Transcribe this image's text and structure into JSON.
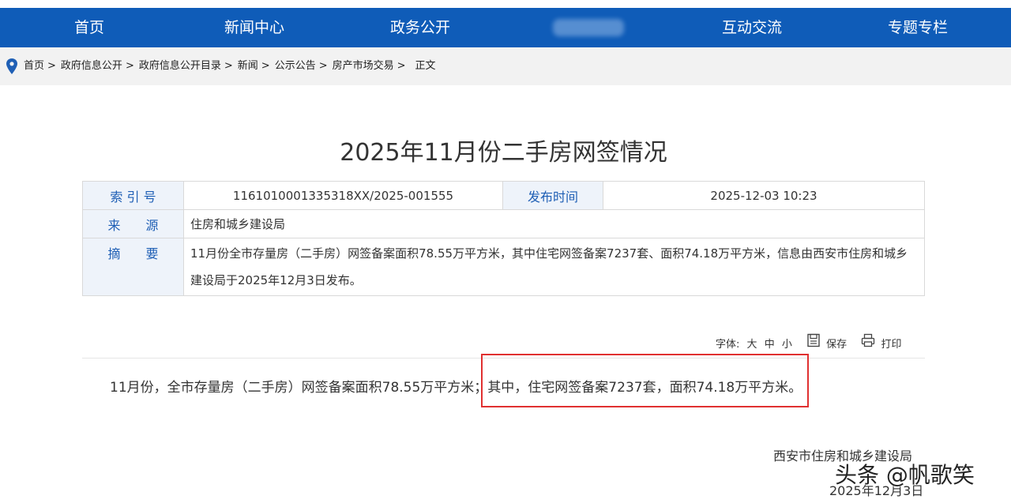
{
  "nav": {
    "items": [
      "首页",
      "新闻中心",
      "政务公开",
      "互动交流",
      "专题专栏"
    ]
  },
  "breadcrumb": {
    "items": [
      "首页",
      "政府信息公开",
      "政府信息公开目录",
      "新闻",
      "公示公告",
      "房产市场交易",
      "正文"
    ],
    "separator": ">"
  },
  "article": {
    "title": "2025年11月份二手房网签情况",
    "info": {
      "index_label": "索 引 号",
      "index_value": "1161010001335318XX/2025-001555",
      "publish_label": "发布时间",
      "publish_value": "2025-12-03 10:23",
      "source_label": "来　　源",
      "source_value": "住房和城乡建设局",
      "summary_label": "摘　　要",
      "summary_line1": "11月份全市存量房（二手房）网签备案面积78.55万平方米，其中住宅网签备案7237套、面积74.18万平方米，信息由西安市住房和城乡",
      "summary_line2": "建设局于2025年12月3日发布。"
    },
    "tools": {
      "font_label": "字体:",
      "sizes": [
        "大",
        "中",
        "小"
      ],
      "save": "保存",
      "print": "打印"
    },
    "body_part1": "11月份，全市存量房（二手房）网签备案面积78.55万平方米；",
    "body_part2": "其中，住宅网签备案7237套，面积74.18万平方米。",
    "signature": "西安市住房和城乡建设局",
    "date": "2025年12月3日"
  },
  "watermark": "头条 @帆歌笑",
  "colors": {
    "nav_bg": "#0f5cb8",
    "label_text": "#1f5fb5",
    "highlight_border": "#e03030"
  }
}
